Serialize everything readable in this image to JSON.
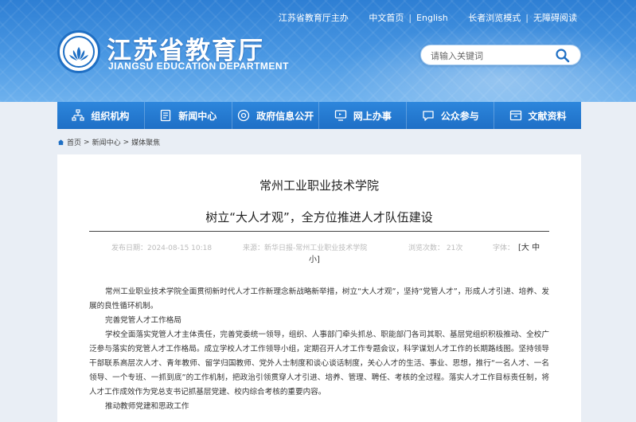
{
  "header": {
    "top_links": {
      "host": "江苏省教育厅主办",
      "chinese": "中文首页",
      "english": "English",
      "elder_mode": "长者浏览模式",
      "accessible": "无障碍阅读"
    },
    "site_title": "江苏省教育厅",
    "site_subtitle": "JIANGSU EDUCATION DEPARTMENT",
    "search_placeholder": "请输入关键词",
    "brand_color": "#2e7fd4"
  },
  "nav": {
    "items": [
      {
        "label": "组织机构",
        "icon": "org-chart-icon"
      },
      {
        "label": "新闻中心",
        "icon": "document-icon"
      },
      {
        "label": "政府信息公开",
        "icon": "info-disclosure-icon"
      },
      {
        "label": "网上办事",
        "icon": "monitor-icon"
      },
      {
        "label": "公众参与",
        "icon": "chat-icon"
      },
      {
        "label": "文献资料",
        "icon": "archive-icon"
      }
    ]
  },
  "breadcrumb": {
    "home": "首页",
    "news": "新闻中心",
    "current": "媒体聚焦",
    "sep1": ">",
    "sep2": ">"
  },
  "article": {
    "title1": "常州工业职业技术学院",
    "title2": "树立“大人才观”，全方位推进人才队伍建设",
    "publish_date": "发布日期：2024-08-15 10:18",
    "source": "来源：新华日报-常州工业职业技术学院",
    "views": "浏览次数：  21次",
    "font_label": "字体：",
    "font_options": "[大 中",
    "font_options_wrap": "小]",
    "paragraphs": [
      "常州工业职业技术学院全面贯彻新时代人才工作新理念新战略新举措，树立“大人才观”，坚持“党管人才”，形成人才引进、培养、发展的良性循环机制。",
      "完善党管人才工作格局",
      "学校全面落实党管人才主体责任，完善党委统一领导，组织、人事部门牵头抓总、职能部门各司其职、基层党组织积极推动、全校广泛参与落实的党管人才工作格局。成立学校人才工作领导小组，定期召开人才工作专题会议，科学谋划人才工作的长期路线图。坚持领导干部联系高层次人才、青年教师、留学归国教师、党外人士制度和谈心谈话制度，关心人才的生活、事业、思想，推行“一名人才、一名领导、一个专班、一抓到底”的工作机制，把政治引领贯穿人才引进、培养、管理、聘任、考核的全过程。落实人才工作目标责任制，将人才工作成效作为党总支书记抓基层党建、校内综合考核的重要内容。",
      "推动教师党建和思政工作"
    ]
  }
}
